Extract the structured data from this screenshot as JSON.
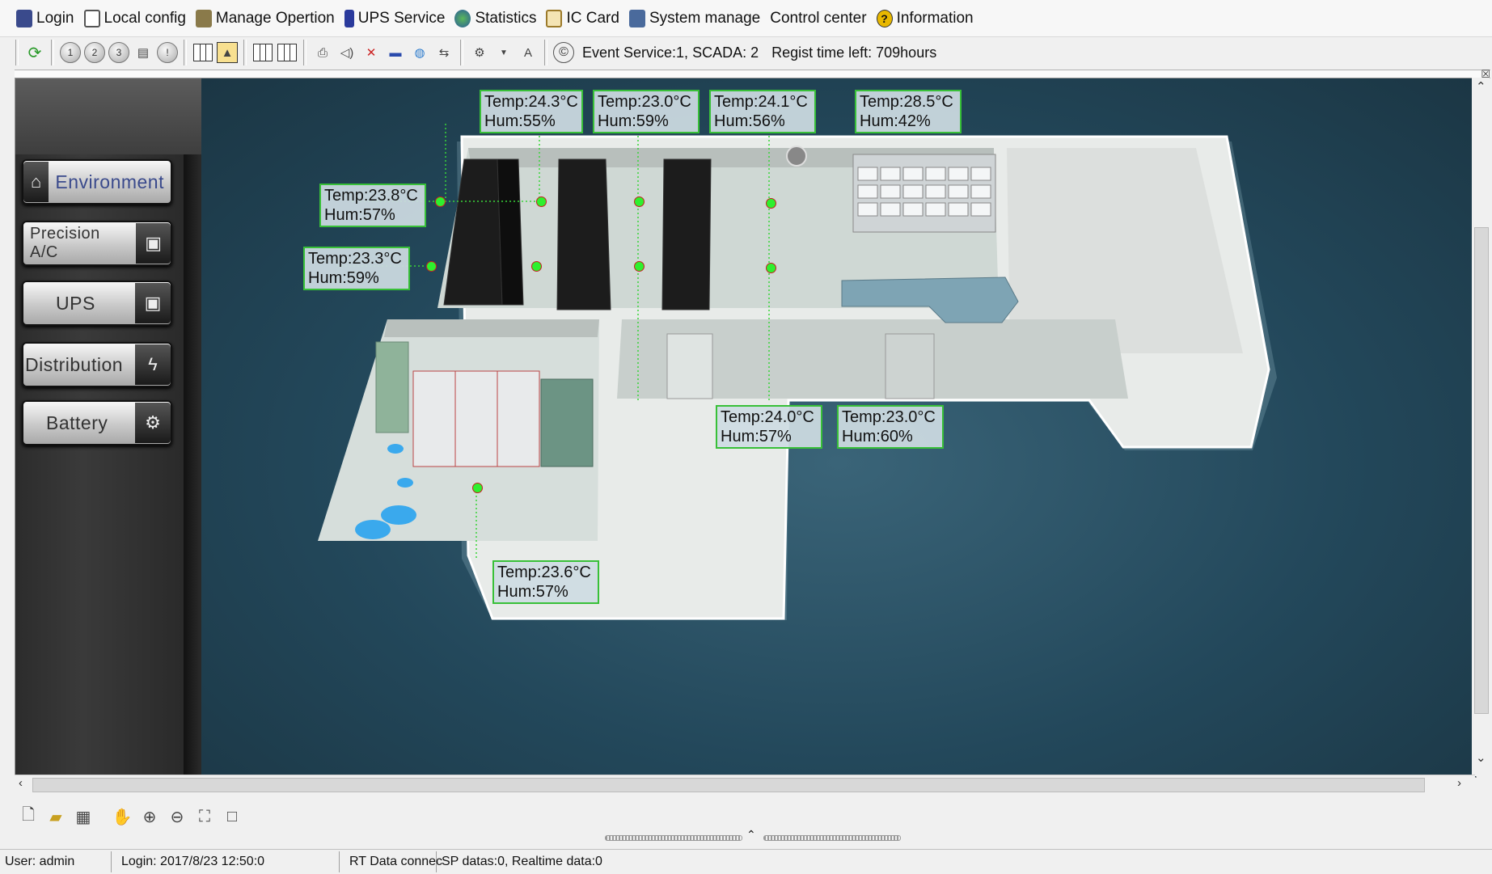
{
  "menu": [
    {
      "label": "Login",
      "icon": "login-icon",
      "color": "#3a4a8c"
    },
    {
      "label": "Local config",
      "icon": "local-config-icon",
      "color": "#555555"
    },
    {
      "label": "Manage Opertion",
      "icon": "manage-operation-icon",
      "color": "#6a5a2a"
    },
    {
      "label": "UPS Service",
      "icon": "ups-service-icon",
      "color": "#2a3a9c"
    },
    {
      "label": "Statistics",
      "icon": "statistics-icon",
      "color": "#2a7a3a"
    },
    {
      "label": "IC Card",
      "icon": "ic-card-icon",
      "color": "#9c7a2a"
    },
    {
      "label": "System manage",
      "icon": "system-manage-icon",
      "color": "#3a5a8c"
    },
    {
      "label": "Control center",
      "icon": "",
      "color": ""
    },
    {
      "label": "Information",
      "icon": "information-icon",
      "color": "#d8a800"
    }
  ],
  "toolbar": {
    "circle_labels": [
      "1",
      "2",
      "3"
    ],
    "font_button": "A",
    "copyright_glyph": "©",
    "status_text": "Event Service:1, SCADA: 2",
    "regist_text": "Regist time left: 709hours"
  },
  "nav": [
    {
      "label": "Environment",
      "icon": "home-icon",
      "glyph": "⌂"
    },
    {
      "label": "Precision A/C",
      "icon": "ac-unit-icon",
      "glyph": "▣"
    },
    {
      "label": "UPS",
      "icon": "ups-unit-icon",
      "glyph": "▣"
    },
    {
      "label": "Distribution",
      "icon": "lightning-icon",
      "glyph": "ϟ"
    },
    {
      "label": "Battery",
      "icon": "battery-icon",
      "glyph": "⚙"
    }
  ],
  "sensors": [
    {
      "temp": "Temp:24.3°C",
      "hum": "Hum:55%"
    },
    {
      "temp": "Temp:23.0°C",
      "hum": "Hum:59%"
    },
    {
      "temp": "Temp:24.1°C",
      "hum": "Hum:56%"
    },
    {
      "temp": "Temp:28.5°C",
      "hum": "Hum:42%"
    },
    {
      "temp": "Temp:23.8°C",
      "hum": "Hum:57%"
    },
    {
      "temp": "Temp:23.3°C",
      "hum": "Hum:59%"
    },
    {
      "temp": "Temp:24.0°C",
      "hum": "Hum:57%"
    },
    {
      "temp": "Temp:23.0°C",
      "hum": "Hum:60%"
    },
    {
      "temp": "Temp:23.6°C",
      "hum": "Hum:57%"
    }
  ],
  "status": {
    "user": "User:  admin",
    "login": "Login:  2017/8/23 12:50:0",
    "rt": "RT Data connec",
    "sp": "SP datas:0, Realtime data:0"
  },
  "colors": {
    "sensor_border": "#38c038",
    "sensor_dot": "#2ef02e",
    "floor_bg": "#23485b"
  }
}
